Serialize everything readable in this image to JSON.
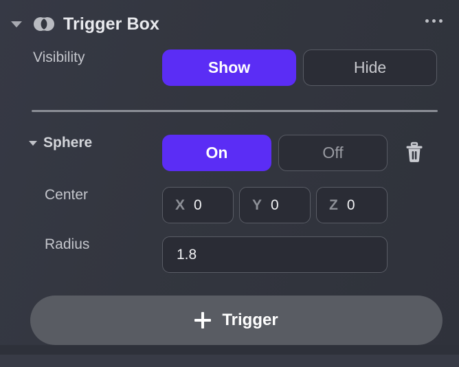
{
  "header": {
    "collapse_icon": "triangle-down-icon",
    "object_icon": "venn-intersection-icon",
    "title": "Trigger Box",
    "more_icon": "more-horizontal-icon"
  },
  "visibility_row": {
    "label": "Visibility",
    "options": [
      {
        "label": "Show",
        "state": "active"
      },
      {
        "label": "Hide",
        "state": "inactive"
      }
    ]
  },
  "sphere_row": {
    "collapse_icon": "chevron-down-icon",
    "label": "Sphere",
    "options": [
      {
        "label": "On",
        "state": "active"
      },
      {
        "label": "Off",
        "state": "inactive"
      }
    ],
    "delete_icon": "trash-icon"
  },
  "center_row": {
    "label": "Center",
    "fields": [
      {
        "axis": "X",
        "value": "0"
      },
      {
        "axis": "Y",
        "value": "0"
      },
      {
        "axis": "Z",
        "value": "0"
      }
    ]
  },
  "radius_row": {
    "label": "Radius",
    "value": "1.8"
  },
  "trigger_button": {
    "icon": "plus-icon",
    "label": "Trigger"
  },
  "colors": {
    "panel_background": "#33363F",
    "accent_active": "#5B2DF5",
    "field_background": "#2A2C35",
    "field_border": "#5A5D66",
    "divider": "#8C8F97",
    "pill_button": "#595C63",
    "label_text": "#C4C6CC",
    "title_text": "#E9EAEE"
  }
}
